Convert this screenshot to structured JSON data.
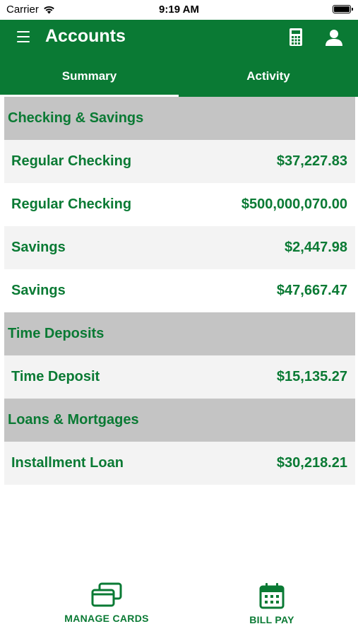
{
  "status_bar": {
    "carrier": "Carrier",
    "time": "9:19 AM"
  },
  "header": {
    "title": "Accounts",
    "menu_icon": "menu-icon",
    "calculator_icon": "calculator-icon",
    "user_icon": "user-icon"
  },
  "tabs": [
    {
      "label": "Summary",
      "selected": true
    },
    {
      "label": "Activity",
      "selected": false
    }
  ],
  "sections": [
    {
      "title": "Checking & Savings",
      "accounts": [
        {
          "name": "Regular Checking",
          "amount": "$37,227.83"
        },
        {
          "name": "Regular Checking",
          "amount": "$500,000,070.00"
        },
        {
          "name": "Savings",
          "amount": "$2,447.98"
        },
        {
          "name": "Savings",
          "amount": "$47,667.47"
        }
      ]
    },
    {
      "title": "Time Deposits",
      "accounts": [
        {
          "name": "Time Deposit",
          "amount": "$15,135.27"
        }
      ]
    },
    {
      "title": "Loans & Mortgages",
      "accounts": [
        {
          "name": "Installment Loan",
          "amount": "$30,218.21"
        }
      ]
    }
  ],
  "bottom_bar": {
    "manage_cards": {
      "label": "MANAGE CARDS",
      "icon": "cards-icon"
    },
    "bill_pay": {
      "label": "BILL PAY",
      "icon": "calendar-icon"
    }
  },
  "colors": {
    "brand": "#0a7a34",
    "section_bg": "#c4c4c4",
    "row_alt_bg": "#f3f3f3"
  }
}
